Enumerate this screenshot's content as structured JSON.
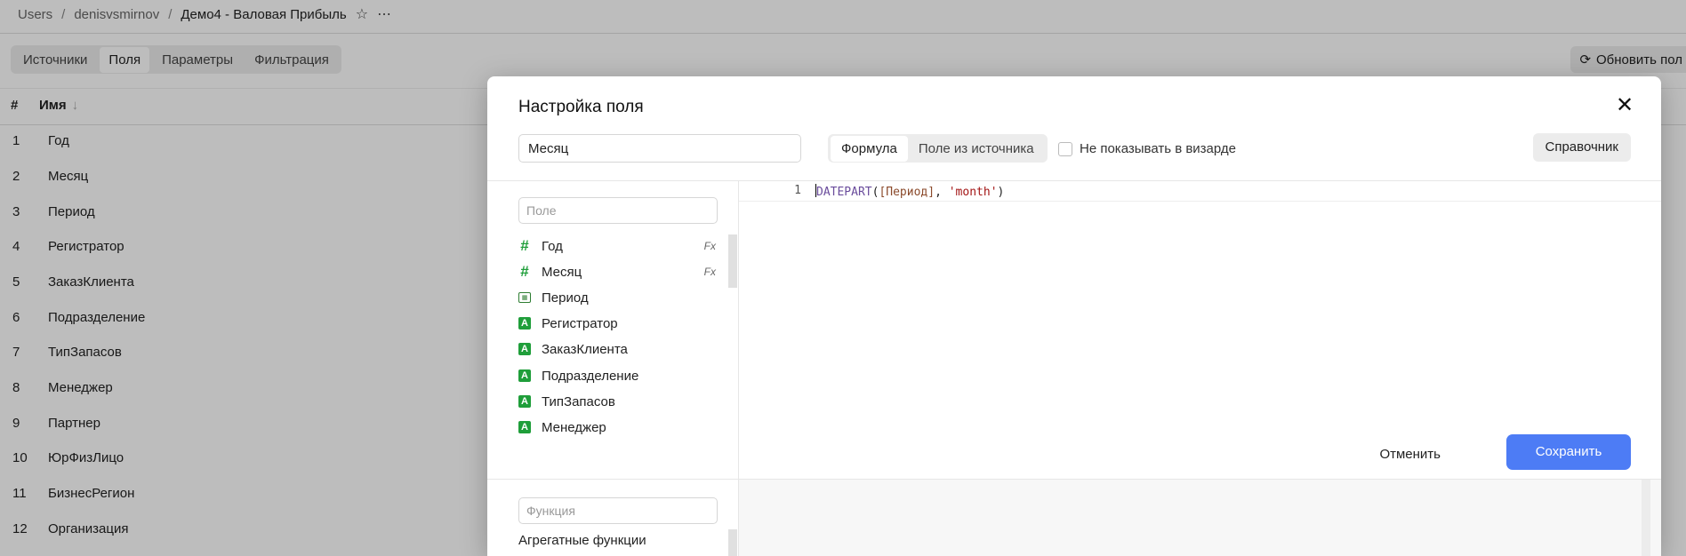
{
  "breadcrumb": {
    "items": [
      "Users",
      "denisvsmirnov",
      "Демо4 - Валовая Прибыль"
    ]
  },
  "bg_tabs": [
    {
      "label": "Источники",
      "active": false
    },
    {
      "label": "Поля",
      "active": true
    },
    {
      "label": "Параметры",
      "active": false
    },
    {
      "label": "Фильтрация",
      "active": false
    }
  ],
  "refresh_label": "Обновить пол",
  "table": {
    "headers": {
      "num": "#",
      "name": "Имя",
      "sort": "↓"
    },
    "rows": [
      {
        "n": "1",
        "name": "Год"
      },
      {
        "n": "2",
        "name": "Месяц"
      },
      {
        "n": "3",
        "name": "Период"
      },
      {
        "n": "4",
        "name": "Регистратор"
      },
      {
        "n": "5",
        "name": "ЗаказКлиента"
      },
      {
        "n": "6",
        "name": "Подразделение"
      },
      {
        "n": "7",
        "name": "ТипЗапасов"
      },
      {
        "n": "8",
        "name": "Менеджер"
      },
      {
        "n": "9",
        "name": "Партнер"
      },
      {
        "n": "10",
        "name": "ЮрФизЛицо"
      },
      {
        "n": "11",
        "name": "БизнесРегион"
      },
      {
        "n": "12",
        "name": "Организация"
      }
    ]
  },
  "modal": {
    "title": "Настройка поля",
    "close_icon": "✕",
    "field_name_value": "Месяц",
    "mode_tabs": [
      {
        "label": "Формула",
        "active": true
      },
      {
        "label": "Поле из источника",
        "active": false
      }
    ],
    "checkbox_label": "Не показывать в визарде",
    "reference_button": "Справочник",
    "field_search_placeholder": "Поле",
    "fields": [
      {
        "label": "Год",
        "icon": "number-icon",
        "glyph": "#",
        "fx": "Fx"
      },
      {
        "label": "Месяц",
        "icon": "number-icon",
        "glyph": "#",
        "fx": "Fx"
      },
      {
        "label": "Период",
        "icon": "date-icon",
        "glyph": "▦",
        "fx": ""
      },
      {
        "label": "Регистратор",
        "icon": "string-icon",
        "glyph": "A",
        "fx": ""
      },
      {
        "label": "ЗаказКлиента",
        "icon": "string-icon",
        "glyph": "A",
        "fx": ""
      },
      {
        "label": "Подразделение",
        "icon": "string-icon",
        "glyph": "A",
        "fx": ""
      },
      {
        "label": "ТипЗапасов",
        "icon": "string-icon",
        "glyph": "A",
        "fx": ""
      },
      {
        "label": "Менеджер",
        "icon": "string-icon",
        "glyph": "A",
        "fx": ""
      }
    ],
    "editor": {
      "line_number": "1",
      "tokens": {
        "fn": "DATEPART",
        "open": "(",
        "field": "[Период]",
        "comma": ", ",
        "str": "'month'",
        "close": ")"
      }
    },
    "cancel_button": "Отменить",
    "save_button": "Сохранить",
    "function_search_placeholder": "Функция",
    "function_group": "Агрегатные функции"
  },
  "colors": {
    "accent": "#4d7cf5",
    "field_icon_green": "#1f9e3a"
  }
}
